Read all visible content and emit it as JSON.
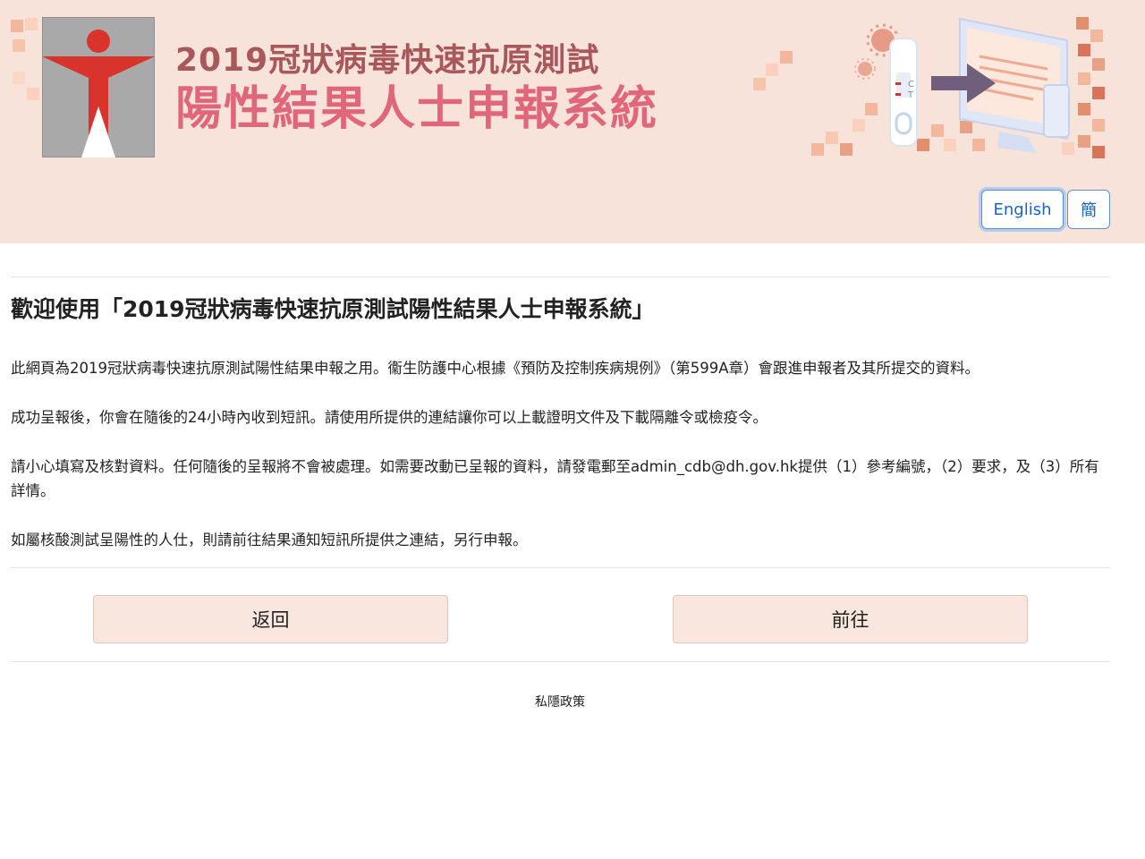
{
  "header": {
    "title_line1": "2019冠狀病毒快速抗原測試",
    "title_line2": "陽性結果人士申報系統",
    "english_button": "English",
    "simplified_button": "簡",
    "test_kit_c": "C",
    "test_kit_t": "T",
    "colors": {
      "background": "#f8e3da",
      "title1": "#a8575b",
      "title2": "#e0667a",
      "logo_red": "#d9342b"
    }
  },
  "main": {
    "heading": "歡迎使用「2019冠狀病毒快速抗原測試陽性結果人士申報系統」",
    "paragraphs": [
      "此網頁為2019冠狀病毒快速抗原測試陽性結果申報之用。衞生防護中心根據《預防及控制疾病規例》（第599A章）會跟進申報者及其所提交的資料。",
      "成功呈報後，你會在隨後的24小時內收到短訊。請使用所提供的連結讓你可以上載證明文件及下載隔離令或檢疫令。",
      "請小心填寫及核對資料。任何隨後的呈報將不會被處理。如需要改動已呈報的資料，請發電郵至admin_cdb@dh.gov.hk提供（1）參考編號，（2）要求，及（3）所有詳情。",
      "如屬核酸測試呈陽性的人仕，則請前往結果通知短訊所提供之連結，另行申報。"
    ]
  },
  "actions": {
    "back_label": "返回",
    "next_label": "前往"
  },
  "footer": {
    "privacy_label": "私隱政策"
  }
}
